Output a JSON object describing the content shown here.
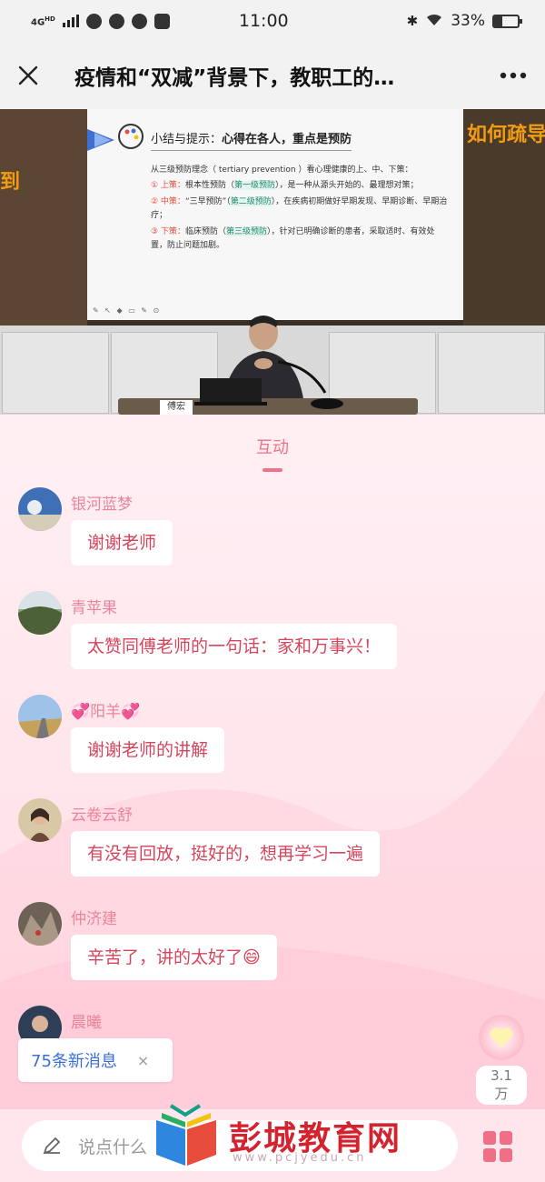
{
  "status": {
    "network": "4G",
    "network_sup": "HD",
    "time": "11:00",
    "battery": "33%",
    "battery_level": 0.33
  },
  "header": {
    "title": "疫情和“双减”背景下，教职工的…"
  },
  "video": {
    "overlay_left": "到",
    "overlay_right": "如何疏导",
    "slide": {
      "heading_prefix": "小结与提示：",
      "heading_bold": "心得在各人，重点是预防",
      "intro": "从三级预防理念（ tertiary prevention ）看心理健康的上、中、下策：",
      "items": [
        {
          "num": "① 上策：",
          "text1": "根本性预防（",
          "highlight": "第一级预防",
          "text2": "），是一种从源头开始的、最理想对策；"
        },
        {
          "num": "② 中策：",
          "text1": "“三早预防”（",
          "highlight": "第二级预防",
          "text2": "），在疾病初期做好早期发现、早期诊断、早期治疗；"
        },
        {
          "num": "③ 下策：",
          "text1": "临床预防（",
          "highlight": "第三级预防",
          "text2": "），针对已明确诊断的患者，采取适时、有效处置，防止问题加剧。"
        }
      ]
    },
    "nameplate": "傅宏"
  },
  "tabs": {
    "active": "互动"
  },
  "messages": [
    {
      "nick": "银河蓝梦",
      "text": "谢谢老师",
      "avatar": "avatar-sky"
    },
    {
      "nick": "青苹果",
      "text": "太赞同傅老师的一句话：家和万事兴！",
      "avatar": "avatar-landscape"
    },
    {
      "nick": "阳羊",
      "nick_decor": "💞",
      "text": "谢谢老师的讲解",
      "avatar": "avatar-road"
    },
    {
      "nick": "云卷云舒",
      "text": "有没有回放，挺好的，想再学习一遍",
      "avatar": "avatar-portrait"
    },
    {
      "nick": "仲济建",
      "text": "辛苦了，讲的太好了😄",
      "avatar": "avatar-rocks"
    },
    {
      "nick": "晨曦",
      "text": "",
      "avatar": "avatar-person"
    }
  ],
  "new_messages": {
    "label": "75条新消息",
    "close": "×"
  },
  "likes": {
    "count": "3.1万"
  },
  "input": {
    "placeholder": "说点什么"
  },
  "watermark": {
    "text": "彭城教育网",
    "url": "www.pcjyedu.cn"
  },
  "colors": {
    "accent": "#f0708a",
    "message_text": "#d6455c",
    "nick": "#e8859a",
    "link_blue": "#3a6fd8"
  }
}
